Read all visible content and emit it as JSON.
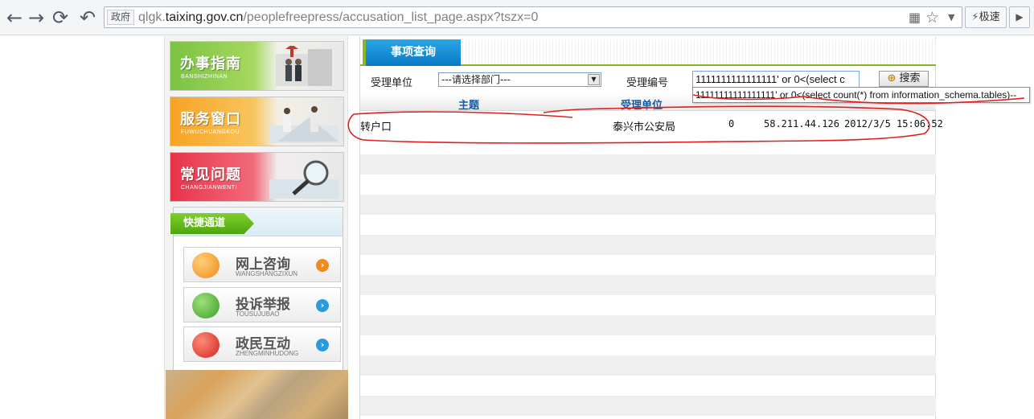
{
  "browser": {
    "url_tag": "政府",
    "url_host_prefix": "qlgk.",
    "url_host_main": "taixing.gov.cn",
    "url_path": "/peoplefreepress/accusation_list_page.aspx?tszx=0",
    "speed_label": "极速"
  },
  "sidebar": {
    "banners": [
      {
        "title": "办事指南",
        "pinyin": "BANSHIZHINAN"
      },
      {
        "title": "服务窗口",
        "pinyin": "FUWUCHUANGKOU"
      },
      {
        "title": "常见问题",
        "pinyin": "CHANGJIANWENTI"
      }
    ],
    "quick_title": "快捷通道",
    "quick_items": [
      {
        "title": "网上咨询",
        "pinyin": "WANGSHANGZIXUN"
      },
      {
        "title": "投诉举报",
        "pinyin": "TOUSUJUBAO"
      },
      {
        "title": "政民互动",
        "pinyin": "ZHENGMINHUDONG"
      }
    ]
  },
  "main": {
    "tab_label": "事项查询",
    "search": {
      "unit_label": "受理单位",
      "unit_select_value": "---请选择部门---",
      "code_label": "受理编号",
      "code_value": "1111111111111111' or 0<(select c",
      "button_label": "搜索",
      "suggestion": "11111111111111111' or 0<(select count(*) from information_schema.tables)--"
    },
    "table": {
      "headers": [
        "主题",
        "受理单位",
        "",
        "",
        ""
      ],
      "rows": [
        {
          "subject": "转户口",
          "unit": "泰兴市公安局",
          "count": "0",
          "ip": "58.211.44.126",
          "time": "2012/3/5 15:06:52"
        }
      ]
    }
  }
}
